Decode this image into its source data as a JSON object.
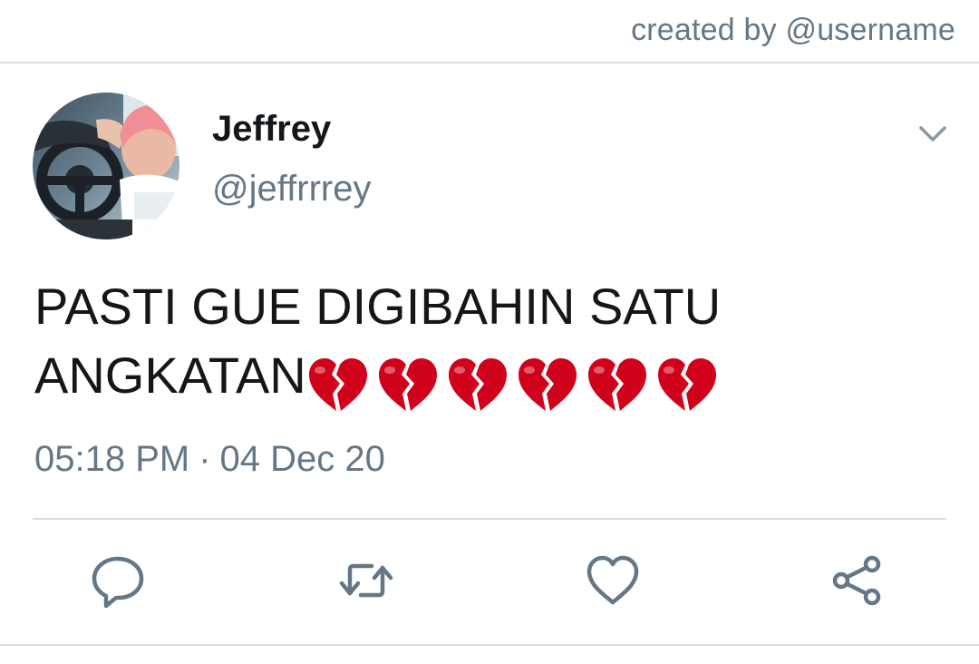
{
  "watermark": {
    "text": "created by @username"
  },
  "tweet": {
    "author": {
      "display_name": "Jeffrey",
      "handle": "@jeffrrrey",
      "avatar": "profile-photo"
    },
    "text": "PASTI GUE DIGIBAHIN SATU ANGKATAN",
    "emoji": {
      "name": "broken-heart",
      "count": 6,
      "color": "#d0021b"
    },
    "time": "05:18 PM",
    "separator": "·",
    "date": "04 Dec 20"
  },
  "actions": [
    {
      "name": "reply",
      "icon": "reply-icon"
    },
    {
      "name": "retweet",
      "icon": "retweet-icon"
    },
    {
      "name": "like",
      "icon": "heart-icon"
    },
    {
      "name": "share",
      "icon": "share-icon"
    }
  ],
  "colors": {
    "text_primary": "#14171a",
    "text_secondary": "#657786",
    "divider": "#d8dde2",
    "icon": "#657786"
  }
}
